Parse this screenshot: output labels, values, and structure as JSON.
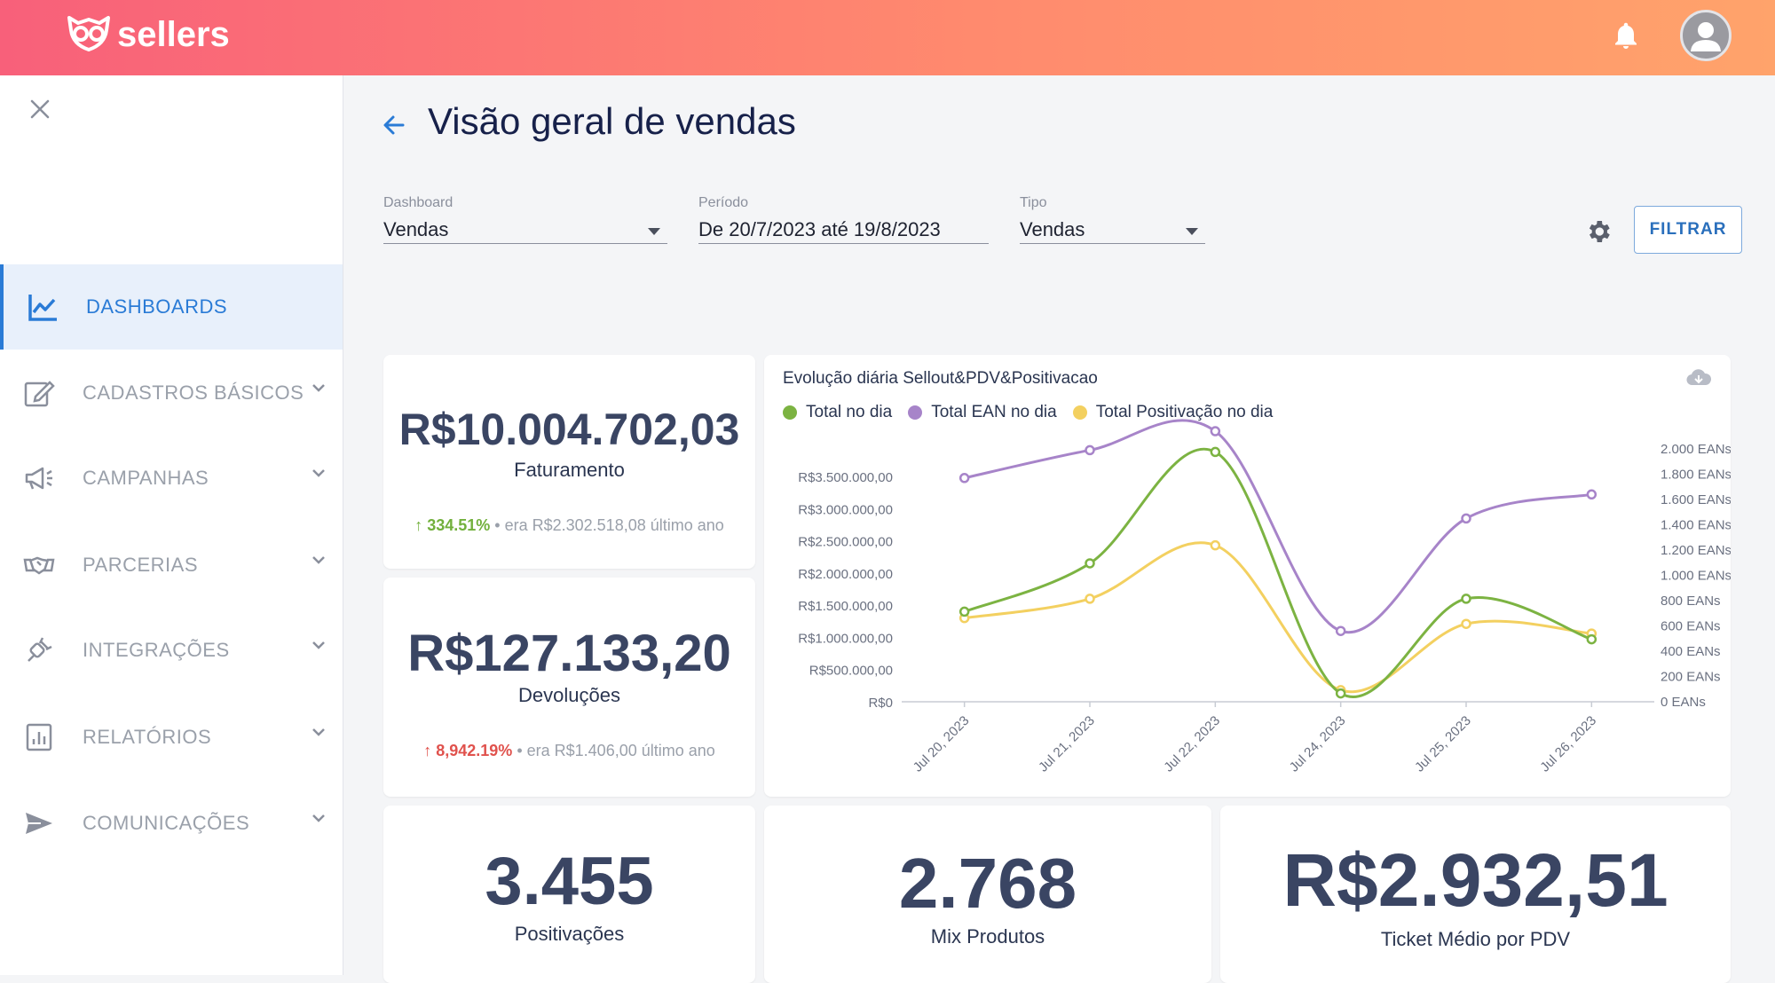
{
  "app": {
    "logo_text": "sellers"
  },
  "sidebar": {
    "items": [
      {
        "label": "DASHBOARDS",
        "icon": "line-chart-icon",
        "active": true
      },
      {
        "label": "CADASTROS BÁSICOS",
        "icon": "edit-icon"
      },
      {
        "label": "CAMPANHAS",
        "icon": "megaphone-icon"
      },
      {
        "label": "PARCERIAS",
        "icon": "handshake-icon"
      },
      {
        "label": "INTEGRAÇÕES",
        "icon": "plug-icon"
      },
      {
        "label": "RELATÓRIOS",
        "icon": "report-icon"
      },
      {
        "label": "COMUNICAÇÕES",
        "icon": "send-icon"
      }
    ]
  },
  "page": {
    "title": "Visão geral de vendas"
  },
  "filters": {
    "dashboard": {
      "label": "Dashboard",
      "value": "Vendas"
    },
    "periodo": {
      "label": "Período",
      "value": "De 20/7/2023 até 19/8/2023"
    },
    "tipo": {
      "label": "Tipo",
      "value": "Vendas"
    },
    "filter_button": "FILTRAR"
  },
  "cards": {
    "faturamento": {
      "value": "R$10.004.702,03",
      "label": "Faturamento",
      "delta": "334.51%",
      "previous": "• era R$2.302.518,08 último ano"
    },
    "devolucoes": {
      "value": "R$127.133,20",
      "label": "Devoluções",
      "delta": "8,942.19%",
      "previous": "• era R$1.406,00 último ano"
    },
    "positivacoes": {
      "value": "3.455",
      "label": "Positivações"
    },
    "mix": {
      "value": "2.768",
      "label": "Mix Produtos"
    },
    "ticket": {
      "value": "R$2.932,51",
      "label": "Ticket Médio por PDV"
    }
  },
  "chart_data": {
    "type": "line",
    "title": "Evolução diária Sellout&PDV&Positivacao",
    "x": [
      "Jul 20, 2023",
      "Jul 21, 2023",
      "Jul 22, 2023",
      "Jul 24, 2023",
      "Jul 25, 2023",
      "Jul 26, 2023"
    ],
    "y_left_ticks": [
      "R$0",
      "R$500.000,00",
      "R$1.000.000,00",
      "R$1.500.000,00",
      "R$2.000.000,00",
      "R$2.500.000,00",
      "R$3.000.000,00",
      "R$3.500.000,00"
    ],
    "y_right_ticks": [
      "0 EANs",
      "200 EANs",
      "400 EANs",
      "600 EANs",
      "800 EANs",
      "1.000 EANs",
      "1.200 EANs",
      "1.400 EANs",
      "1.600 EANs",
      "1.800 EANs",
      "2.000 EANs"
    ],
    "ylim_left": [
      0,
      3500000
    ],
    "ylim_right": [
      0,
      2000
    ],
    "series": [
      {
        "name": "Total no dia",
        "color": "#7cb342",
        "axis": "left",
        "values": [
          1400000,
          2150000,
          3880000,
          130000,
          1600000,
          970000
        ]
      },
      {
        "name": "Total EAN no dia",
        "color": "#a784c9",
        "axis": "right",
        "values": [
          1770,
          1990,
          2140,
          560,
          1450,
          1640
        ]
      },
      {
        "name": "Total Positivação no dia",
        "color": "#f3d060",
        "axis": "left",
        "values": [
          1300000,
          1600000,
          2430000,
          180000,
          1210000,
          1060000
        ]
      }
    ]
  }
}
